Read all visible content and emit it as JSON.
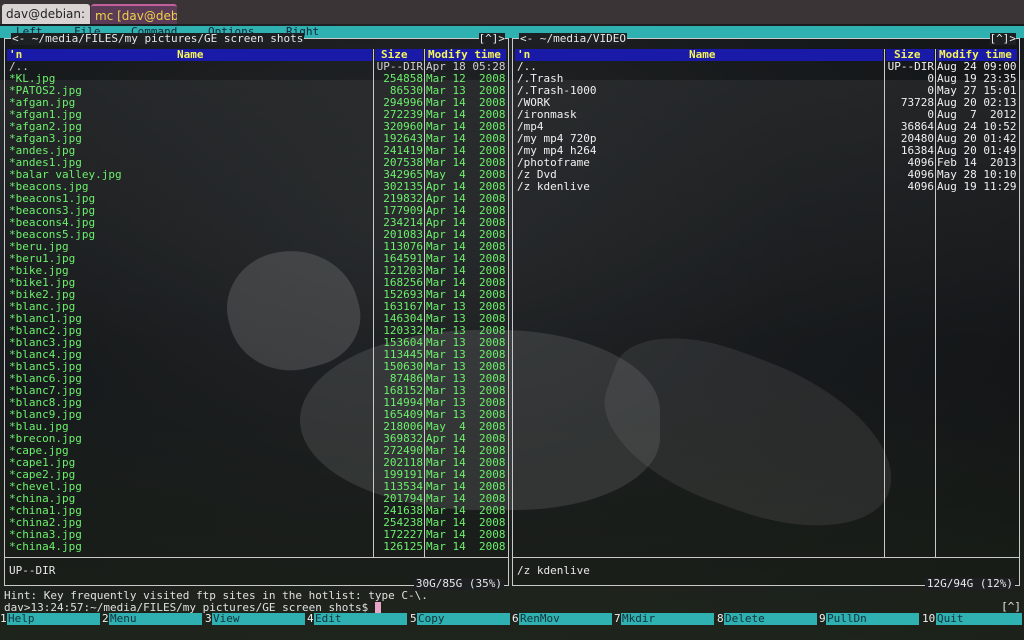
{
  "tabs": [
    {
      "label": "dav@debian: ..."
    },
    {
      "label": "mc [dav@deb..."
    }
  ],
  "menubar": [
    "Left",
    "File",
    "Command",
    "Options",
    "Right"
  ],
  "left_panel": {
    "path": "<- ~/media/FILES/my pictures/GE screen shots",
    "corner": "[^]>",
    "headers": {
      "name_sort": "'n",
      "name": "Name",
      "size": "Size",
      "mtime": "Modify time"
    },
    "rows": [
      {
        "name": "/..",
        "size": "UP--DIR",
        "mtime": "Apr 18 05:28"
      },
      {
        "name": "*KL.jpg",
        "size": "254858",
        "mtime": "Mar 12  2008"
      },
      {
        "name": "*PATOS2.jpg",
        "size": "86530",
        "mtime": "Mar 13  2008"
      },
      {
        "name": "*afgan.jpg",
        "size": "294996",
        "mtime": "Mar 14  2008"
      },
      {
        "name": "*afgan1.jpg",
        "size": "272239",
        "mtime": "Mar 14  2008"
      },
      {
        "name": "*afgan2.jpg",
        "size": "320960",
        "mtime": "Mar 14  2008"
      },
      {
        "name": "*afgan3.jpg",
        "size": "192643",
        "mtime": "Mar 14  2008"
      },
      {
        "name": "*andes.jpg",
        "size": "241419",
        "mtime": "Mar 14  2008"
      },
      {
        "name": "*andes1.jpg",
        "size": "207538",
        "mtime": "Mar 14  2008"
      },
      {
        "name": "*balar valley.jpg",
        "size": "342965",
        "mtime": "May  4  2008"
      },
      {
        "name": "*beacons.jpg",
        "size": "302135",
        "mtime": "Apr 14  2008"
      },
      {
        "name": "*beacons1.jpg",
        "size": "219832",
        "mtime": "Apr 14  2008"
      },
      {
        "name": "*beacons3.jpg",
        "size": "177909",
        "mtime": "Apr 14  2008"
      },
      {
        "name": "*beacons4.jpg",
        "size": "234214",
        "mtime": "Apr 14  2008"
      },
      {
        "name": "*beacons5.jpg",
        "size": "201083",
        "mtime": "Apr 14  2008"
      },
      {
        "name": "*beru.jpg",
        "size": "113076",
        "mtime": "Mar 14  2008"
      },
      {
        "name": "*beru1.jpg",
        "size": "164591",
        "mtime": "Mar 14  2008"
      },
      {
        "name": "*bike.jpg",
        "size": "121203",
        "mtime": "Mar 14  2008"
      },
      {
        "name": "*bike1.jpg",
        "size": "168256",
        "mtime": "Mar 14  2008"
      },
      {
        "name": "*bike2.jpg",
        "size": "152693",
        "mtime": "Mar 14  2008"
      },
      {
        "name": "*blanc.jpg",
        "size": "163167",
        "mtime": "Mar 13  2008"
      },
      {
        "name": "*blanc1.jpg",
        "size": "146304",
        "mtime": "Mar 13  2008"
      },
      {
        "name": "*blanc2.jpg",
        "size": "120332",
        "mtime": "Mar 13  2008"
      },
      {
        "name": "*blanc3.jpg",
        "size": "153604",
        "mtime": "Mar 13  2008"
      },
      {
        "name": "*blanc4.jpg",
        "size": "113445",
        "mtime": "Mar 13  2008"
      },
      {
        "name": "*blanc5.jpg",
        "size": "150630",
        "mtime": "Mar 13  2008"
      },
      {
        "name": "*blanc6.jpg",
        "size": "87486",
        "mtime": "Mar 13  2008"
      },
      {
        "name": "*blanc7.jpg",
        "size": "168152",
        "mtime": "Mar 13  2008"
      },
      {
        "name": "*blanc8.jpg",
        "size": "114994",
        "mtime": "Mar 13  2008"
      },
      {
        "name": "*blanc9.jpg",
        "size": "165409",
        "mtime": "Mar 13  2008"
      },
      {
        "name": "*blau.jpg",
        "size": "218006",
        "mtime": "May  4  2008"
      },
      {
        "name": "*brecon.jpg",
        "size": "369832",
        "mtime": "Apr 14  2008"
      },
      {
        "name": "*cape.jpg",
        "size": "272490",
        "mtime": "Mar 14  2008"
      },
      {
        "name": "*cape1.jpg",
        "size": "202118",
        "mtime": "Mar 14  2008"
      },
      {
        "name": "*cape2.jpg",
        "size": "199191",
        "mtime": "Mar 14  2008"
      },
      {
        "name": "*chevel.jpg",
        "size": "113534",
        "mtime": "Mar 14  2008"
      },
      {
        "name": "*china.jpg",
        "size": "201794",
        "mtime": "Mar 14  2008"
      },
      {
        "name": "*china1.jpg",
        "size": "241638",
        "mtime": "Mar 14  2008"
      },
      {
        "name": "*china2.jpg",
        "size": "254238",
        "mtime": "Mar 14  2008"
      },
      {
        "name": "*china3.jpg",
        "size": "172227",
        "mtime": "Mar 14  2008"
      },
      {
        "name": "*china4.jpg",
        "size": "126125",
        "mtime": "Mar 14  2008"
      }
    ],
    "status": "UP--DIR",
    "disk": "30G/85G (35%)"
  },
  "right_panel": {
    "path": "<- ~/media/VIDEO",
    "corner": "[^]>",
    "headers": {
      "name_sort": "'n",
      "name": "Name",
      "size": "Size",
      "mtime": "Modify time"
    },
    "rows": [
      {
        "name": "/..",
        "size": "UP--DIR",
        "mtime": "Aug 24 09:00"
      },
      {
        "name": "/.Trash",
        "size": "0",
        "mtime": "Aug 19 23:35"
      },
      {
        "name": "/.Trash-1000",
        "size": "0",
        "mtime": "May 27 15:01"
      },
      {
        "name": "/WORK",
        "size": "73728",
        "mtime": "Aug 20 02:13"
      },
      {
        "name": "/ironmask",
        "size": "0",
        "mtime": "Aug  7  2012"
      },
      {
        "name": "/mp4",
        "size": "36864",
        "mtime": "Aug 24 10:52"
      },
      {
        "name": "/my mp4 720p",
        "size": "20480",
        "mtime": "Aug 20 01:42"
      },
      {
        "name": "/my mp4 h264",
        "size": "16384",
        "mtime": "Aug 20 01:49"
      },
      {
        "name": "/photoframe",
        "size": "4096",
        "mtime": "Feb 14  2013"
      },
      {
        "name": "/z Dvd",
        "size": "4096",
        "mtime": "May 28 10:10"
      },
      {
        "name": "/z kdenlive",
        "size": "4096",
        "mtime": "Aug 19 11:29"
      }
    ],
    "status": "/z kdenlive",
    "disk": "12G/94G (12%)"
  },
  "hint": "Hint: Key frequently visited ftp sites in the hotlist: type C-\\.",
  "prompt": "dav>13:24:57:~/media/FILES/my pictures/GE screen shots$ ",
  "prompt_corner": "[^]",
  "fkeys": [
    {
      "num": "1",
      "label": "Help"
    },
    {
      "num": "2",
      "label": "Menu"
    },
    {
      "num": "3",
      "label": "View"
    },
    {
      "num": "4",
      "label": "Edit"
    },
    {
      "num": "5",
      "label": "Copy"
    },
    {
      "num": "6",
      "label": "RenMov"
    },
    {
      "num": "7",
      "label": "Mkdir"
    },
    {
      "num": "8",
      "label": "Delete"
    },
    {
      "num": "9",
      "label": "PullDn"
    },
    {
      "num": "10",
      "label": "Quit"
    }
  ],
  "colors": {
    "menubar": "#2fb1b1",
    "header_bg": "#1a1aa8",
    "header_fg": "#f4f459",
    "file_fg": "#6cf06c",
    "dir_fg": "#f0f0f0"
  }
}
